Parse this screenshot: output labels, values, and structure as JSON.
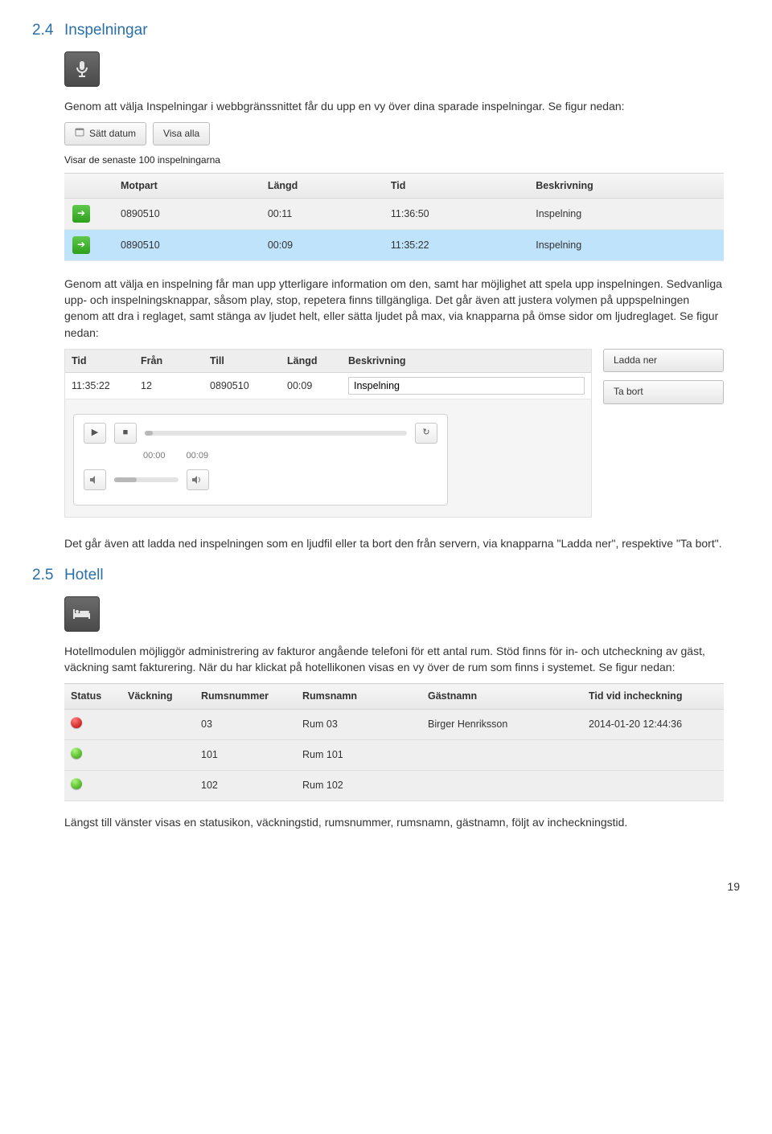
{
  "section24": {
    "num": "2.4",
    "title": "Inspelningar"
  },
  "p24a": "Genom att välja Inspelningar i webbgränssnittet får du upp en vy över dina sparade inspelningar. Se figur nedan:",
  "toolbar1": {
    "set_date": "Sätt datum",
    "show_all": "Visa alla"
  },
  "subtle1": "Visar de senaste 100 inspelningarna",
  "tbl1": {
    "headers": {
      "h0": "",
      "h1": "Motpart",
      "h2": "Längd",
      "h3": "Tid",
      "h4": "Beskrivning"
    },
    "rows": [
      {
        "motpart": "0890510",
        "langd": "00:11",
        "tid": "11:36:50",
        "beskr": "Inspelning"
      },
      {
        "motpart": "0890510",
        "langd": "00:09",
        "tid": "11:35:22",
        "beskr": "Inspelning"
      }
    ]
  },
  "p24b": "Genom att välja en inspelning får man upp ytterligare information om den, samt har möjlighet att spela upp inspelningen. Sedvanliga upp- och inspelningsknappar, såsom play, stop, repetera finns tillgängliga. Det går även att justera volymen på uppspelningen genom att dra i reglaget, samt stänga av ljudet helt, eller sätta ljudet på max, via knapparna på ömse sidor om ljudreglaget. Se figur nedan:",
  "tbl2": {
    "headers": {
      "h0": "Tid",
      "h1": "Från",
      "h2": "Till",
      "h3": "Längd",
      "h4": "Beskrivning"
    },
    "row": {
      "tid": "11:35:22",
      "fran": "12",
      "till": "0890510",
      "langd": "00:09",
      "beskr": "Inspelning"
    }
  },
  "player": {
    "t0": "00:00",
    "t1": "00:09"
  },
  "buttons": {
    "download": "Ladda ner",
    "delete": "Ta bort"
  },
  "p24c": "Det går även att ladda ned inspelningen som en ljudfil eller ta bort den från servern, via knapparna \"Ladda ner\", respektive \"Ta bort\".",
  "section25": {
    "num": "2.5",
    "title": "Hotell"
  },
  "p25a": "Hotellmodulen möjliggör administrering av fakturor angående telefoni för ett antal rum. Stöd finns för in- och utcheckning av gäst, väckning samt fakturering. När du har klickat på hotellikonen visas en vy över de rum som finns i systemet. Se figur nedan:",
  "tbl3": {
    "headers": {
      "h0": "Status",
      "h1": "Väckning",
      "h2": "Rumsnummer",
      "h3": "Rumsnamn",
      "h4": "Gästnamn",
      "h5": "Tid vid incheckning"
    },
    "rows": [
      {
        "status": "red",
        "vack": "",
        "nr": "03",
        "namn": "Rum 03",
        "gast": "Birger Henriksson",
        "tid": "2014-01-20 12:44:36"
      },
      {
        "status": "green",
        "vack": "",
        "nr": "101",
        "namn": "Rum 101",
        "gast": "",
        "tid": ""
      },
      {
        "status": "green",
        "vack": "",
        "nr": "102",
        "namn": "Rum 102",
        "gast": "",
        "tid": ""
      }
    ]
  },
  "p25b": "Längst till vänster visas en statusikon, väckningstid, rumsnummer, rumsnamn, gästnamn, följt av incheckningstid.",
  "pagenum": "19"
}
